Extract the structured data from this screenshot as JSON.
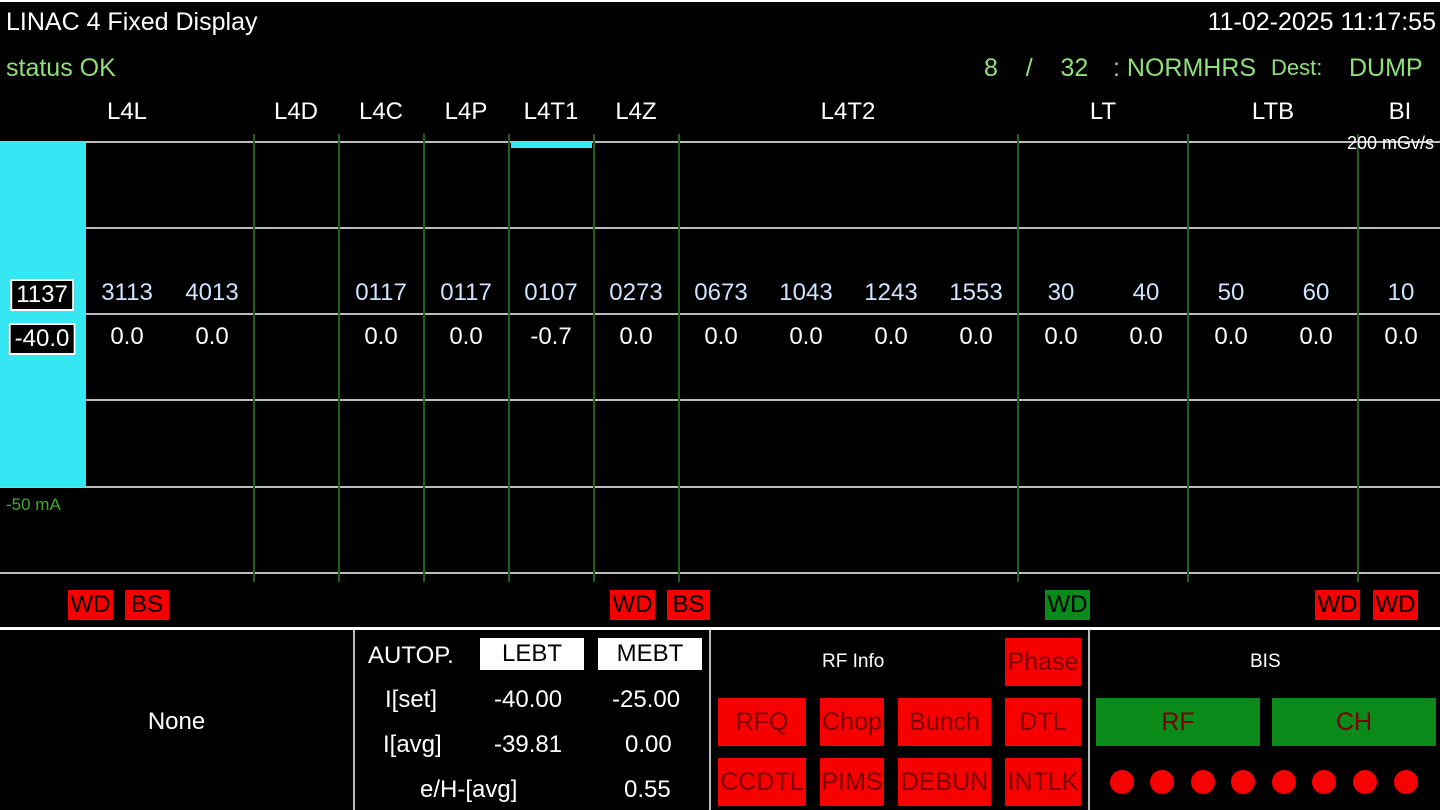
{
  "header": {
    "title": "LINAC 4 Fixed Display",
    "datetime": "11-02-2025 11:17:55",
    "status": "status OK",
    "user_num": "8",
    "user_sep": "/",
    "user_total": "32",
    "cycle": ": NORMHRS",
    "dest_label": "Dest:",
    "dest_value": "DUMP"
  },
  "sections": [
    "L4L",
    "L4D",
    "L4C",
    "L4P",
    "L4T1",
    "L4Z",
    "L4T2",
    "LT",
    "LTB",
    "BI"
  ],
  "scale": {
    "top": "200 mGv/s",
    "bottom": "-50 mA"
  },
  "beam_bar_color": "#35e7f2",
  "channels": [
    "1137",
    "3113",
    "4013",
    "0117",
    "0117",
    "0107",
    "0273",
    "0673",
    "1043",
    "1243",
    "1553",
    "30",
    "40",
    "50",
    "60",
    "10"
  ],
  "values": [
    "-40.0",
    "0.0",
    "0.0",
    "0.0",
    "0.0",
    "-0.7",
    "0.0",
    "0.0",
    "0.0",
    "0.0",
    "0.0",
    "0.0",
    "0.0",
    "0.0",
    "0.0",
    "0.0"
  ],
  "flags": [
    "WD",
    "BS",
    "WD",
    "BS",
    "WD",
    "WD",
    "WD"
  ],
  "flag_colors": {
    "red": "#f60000",
    "green": "#0a8a18"
  },
  "bottom": {
    "none_text": "None",
    "autop_label": "AUTOP.",
    "col_lebt": "LEBT",
    "col_mebt": "MEBT",
    "rows": [
      {
        "label": "I[set]",
        "lebt": "-40.00",
        "mebt": "-25.00"
      },
      {
        "label": "I[avg]",
        "lebt": "-39.81",
        "mebt": "0.00"
      },
      {
        "label": "e/H-[avg]",
        "mebt": "0.55"
      }
    ],
    "rf_title": "RF Info",
    "rf_buttons": [
      "Phase",
      "RFQ",
      "Chop",
      "Bunch",
      "DTL",
      "CCDTL",
      "PIMS",
      "DEBUN",
      "INTLK"
    ],
    "bis_title": "BIS",
    "bis_buttons": [
      "RF",
      "CH"
    ],
    "bis_dots_count": 8
  }
}
